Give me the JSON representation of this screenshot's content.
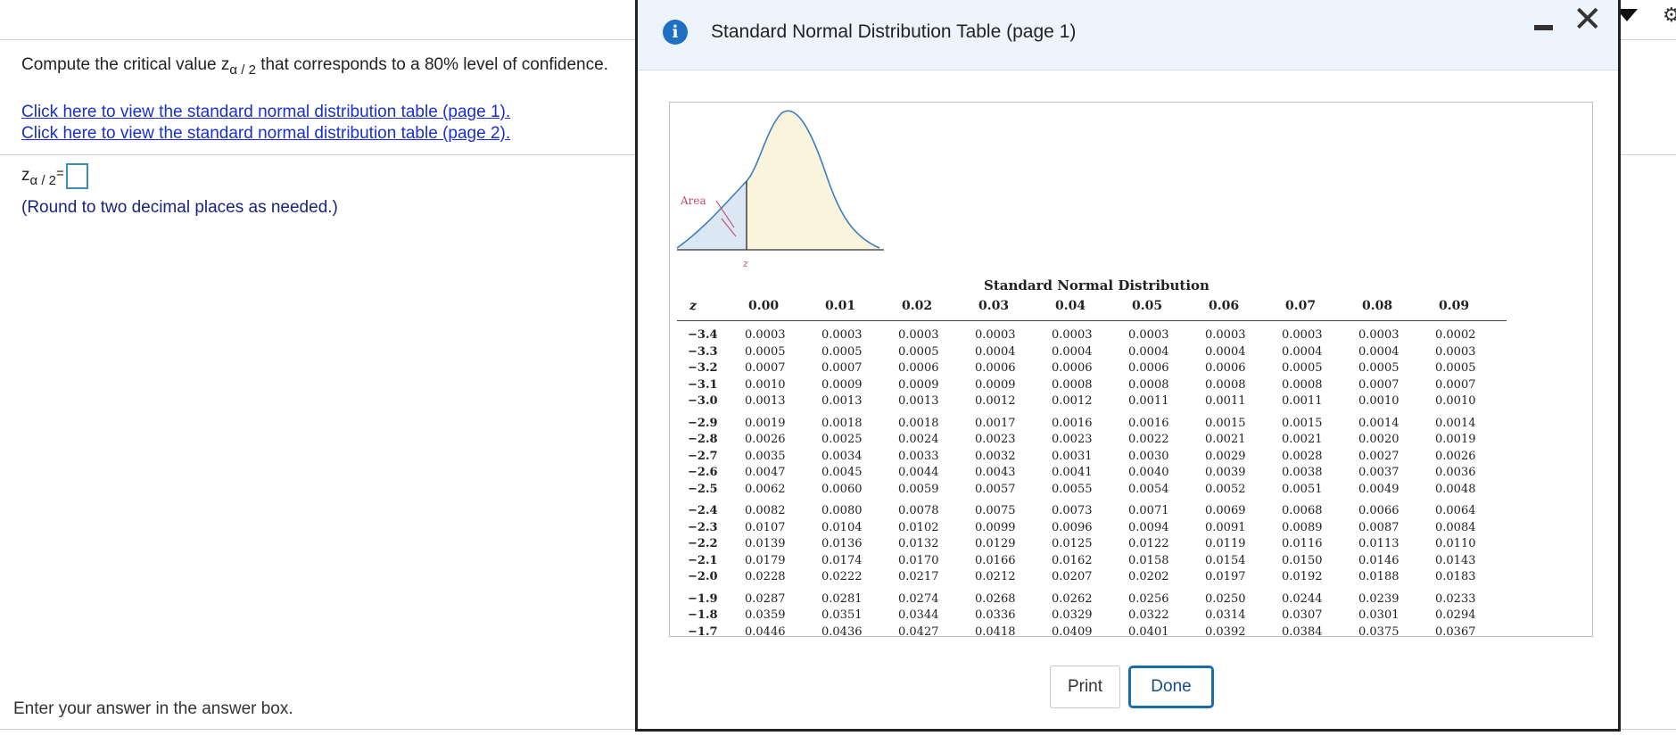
{
  "question": {
    "prefix": "Compute the critical value z",
    "sub": "α / 2",
    "suffix": " that corresponds to a 80% level of confidence."
  },
  "links": {
    "page1": "Click here to view the standard normal distribution table (page 1).",
    "page2": "Click here to view the standard normal distribution table (page 2)."
  },
  "answer": {
    "var": "z",
    "sub": "α / 2",
    "eq": " =",
    "value": "",
    "note": "(Round to two decimal places as needed.)"
  },
  "footer_note": "Enter your answer in the answer box.",
  "dialog": {
    "title": "Standard Normal Distribution Table (page 1)",
    "info_icon": "info-icon",
    "minimize_icon": "minimize-icon",
    "close_glyph": "✕",
    "print_label": "Print",
    "done_label": "Done"
  },
  "figure": {
    "area_label": "Area",
    "z_label": "z"
  },
  "table": {
    "title": "Standard Normal Distribution",
    "z_header": "z",
    "col_headers": [
      "0.00",
      "0.01",
      "0.02",
      "0.03",
      "0.04",
      "0.05",
      "0.06",
      "0.07",
      "0.08",
      "0.09"
    ],
    "groups": [
      [
        {
          "z": "−3.4",
          "v": [
            "0.0003",
            "0.0003",
            "0.0003",
            "0.0003",
            "0.0003",
            "0.0003",
            "0.0003",
            "0.0003",
            "0.0003",
            "0.0002"
          ]
        },
        {
          "z": "−3.3",
          "v": [
            "0.0005",
            "0.0005",
            "0.0005",
            "0.0004",
            "0.0004",
            "0.0004",
            "0.0004",
            "0.0004",
            "0.0004",
            "0.0003"
          ]
        },
        {
          "z": "−3.2",
          "v": [
            "0.0007",
            "0.0007",
            "0.0006",
            "0.0006",
            "0.0006",
            "0.0006",
            "0.0006",
            "0.0005",
            "0.0005",
            "0.0005"
          ]
        },
        {
          "z": "−3.1",
          "v": [
            "0.0010",
            "0.0009",
            "0.0009",
            "0.0009",
            "0.0008",
            "0.0008",
            "0.0008",
            "0.0008",
            "0.0007",
            "0.0007"
          ]
        },
        {
          "z": "−3.0",
          "v": [
            "0.0013",
            "0.0013",
            "0.0013",
            "0.0012",
            "0.0012",
            "0.0011",
            "0.0011",
            "0.0011",
            "0.0010",
            "0.0010"
          ]
        }
      ],
      [
        {
          "z": "−2.9",
          "v": [
            "0.0019",
            "0.0018",
            "0.0018",
            "0.0017",
            "0.0016",
            "0.0016",
            "0.0015",
            "0.0015",
            "0.0014",
            "0.0014"
          ]
        },
        {
          "z": "−2.8",
          "v": [
            "0.0026",
            "0.0025",
            "0.0024",
            "0.0023",
            "0.0023",
            "0.0022",
            "0.0021",
            "0.0021",
            "0.0020",
            "0.0019"
          ]
        },
        {
          "z": "−2.7",
          "v": [
            "0.0035",
            "0.0034",
            "0.0033",
            "0.0032",
            "0.0031",
            "0.0030",
            "0.0029",
            "0.0028",
            "0.0027",
            "0.0026"
          ]
        },
        {
          "z": "−2.6",
          "v": [
            "0.0047",
            "0.0045",
            "0.0044",
            "0.0043",
            "0.0041",
            "0.0040",
            "0.0039",
            "0.0038",
            "0.0037",
            "0.0036"
          ]
        },
        {
          "z": "−2.5",
          "v": [
            "0.0062",
            "0.0060",
            "0.0059",
            "0.0057",
            "0.0055",
            "0.0054",
            "0.0052",
            "0.0051",
            "0.0049",
            "0.0048"
          ]
        }
      ],
      [
        {
          "z": "−2.4",
          "v": [
            "0.0082",
            "0.0080",
            "0.0078",
            "0.0075",
            "0.0073",
            "0.0071",
            "0.0069",
            "0.0068",
            "0.0066",
            "0.0064"
          ]
        },
        {
          "z": "−2.3",
          "v": [
            "0.0107",
            "0.0104",
            "0.0102",
            "0.0099",
            "0.0096",
            "0.0094",
            "0.0091",
            "0.0089",
            "0.0087",
            "0.0084"
          ]
        },
        {
          "z": "−2.2",
          "v": [
            "0.0139",
            "0.0136",
            "0.0132",
            "0.0129",
            "0.0125",
            "0.0122",
            "0.0119",
            "0.0116",
            "0.0113",
            "0.0110"
          ]
        },
        {
          "z": "−2.1",
          "v": [
            "0.0179",
            "0.0174",
            "0.0170",
            "0.0166",
            "0.0162",
            "0.0158",
            "0.0154",
            "0.0150",
            "0.0146",
            "0.0143"
          ]
        },
        {
          "z": "−2.0",
          "v": [
            "0.0228",
            "0.0222",
            "0.0217",
            "0.0212",
            "0.0207",
            "0.0202",
            "0.0197",
            "0.0192",
            "0.0188",
            "0.0183"
          ]
        }
      ],
      [
        {
          "z": "−1.9",
          "v": [
            "0.0287",
            "0.0281",
            "0.0274",
            "0.0268",
            "0.0262",
            "0.0256",
            "0.0250",
            "0.0244",
            "0.0239",
            "0.0233"
          ]
        },
        {
          "z": "−1.8",
          "v": [
            "0.0359",
            "0.0351",
            "0.0344",
            "0.0336",
            "0.0329",
            "0.0322",
            "0.0314",
            "0.0307",
            "0.0301",
            "0.0294"
          ]
        },
        {
          "z": "−1.7",
          "v": [
            "0.0446",
            "0.0436",
            "0.0427",
            "0.0418",
            "0.0409",
            "0.0401",
            "0.0392",
            "0.0384",
            "0.0375",
            "0.0367"
          ]
        }
      ]
    ]
  },
  "colors": {
    "link": "#1b2fd1",
    "accent": "#1f6fc5",
    "done_border": "#1a6ea8",
    "curve": "#3b7fbf",
    "curve_fill": "#fbf4dc"
  }
}
